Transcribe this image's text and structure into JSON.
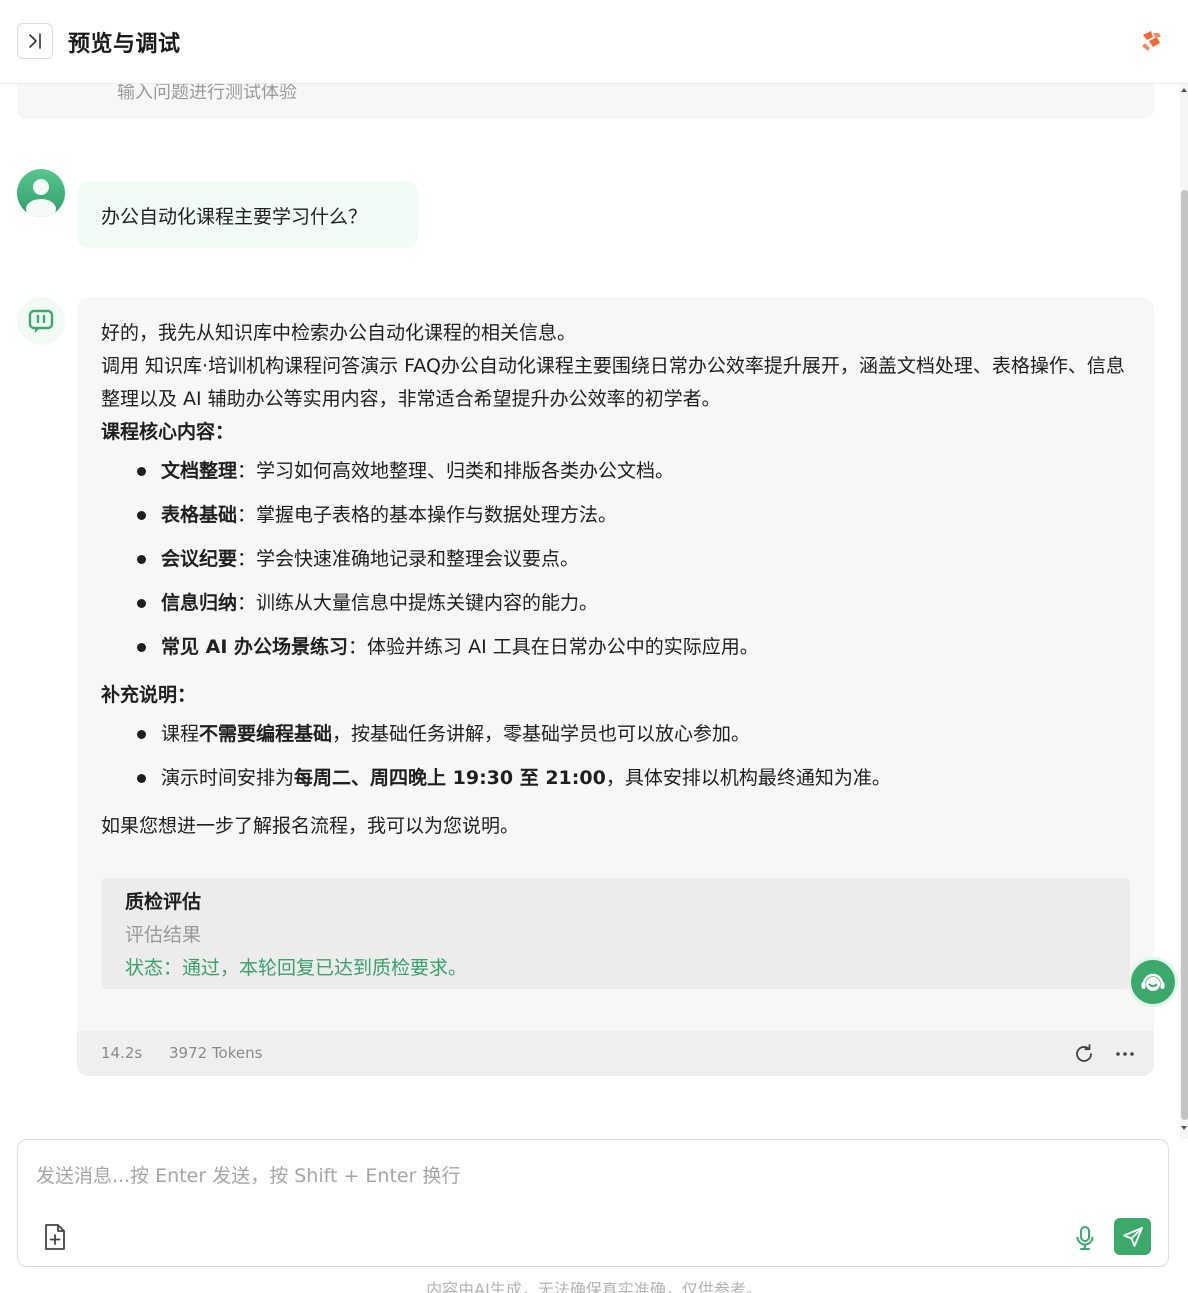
{
  "header": {
    "title": "预览与调试",
    "toggle_icon": "sidebar-expand-icon",
    "brand_icon": "brand-logo-icon",
    "brand_color": "#f2693a"
  },
  "intro": {
    "text": "输入问题进行测试体验"
  },
  "user_message": {
    "text": "办公自动化课程主要学习什么？"
  },
  "bot_message": {
    "line1": "好的，我先从知识库中检索办公自动化课程的相关信息。",
    "line2": "调用 知识库·培训机构课程问答演示 FAQ办公自动化课程主要围绕日常办公效率提升展开，涵盖文档处理、表格操作、信息整理以及 AI 辅助办公等实用内容，非常适合希望提升办公效率的初学者。",
    "core_heading": "课程核心内容：",
    "core_items": [
      {
        "title": "文档整理",
        "sep": "：",
        "desc": "学习如何高效地整理、归类和排版各类办公文档。"
      },
      {
        "title": "表格基础",
        "sep": "：",
        "desc": "掌握电子表格的基本操作与数据处理方法。"
      },
      {
        "title": "会议纪要",
        "sep": "：",
        "desc": "学会快速准确地记录和整理会议要点。"
      },
      {
        "title": "信息归纳",
        "sep": "：",
        "desc": "训练从大量信息中提炼关键内容的能力。"
      },
      {
        "title": "常见 AI 办公场景练习",
        "sep": "：",
        "desc": "体验并练习 AI 工具在日常办公中的实际应用。"
      }
    ],
    "extra_heading": "补充说明：",
    "extra_1": {
      "pre": "课程",
      "bold": "不需要编程基础",
      "post": "，按基础任务讲解，零基础学员也可以放心参加。"
    },
    "extra_2": {
      "pre": "演示时间安排为",
      "bold": "每周二、周四晚上 19:30 至 21:00",
      "post": "，具体安排以机构最终通知为准。"
    },
    "closing": "如果您想进一步了解报名流程，我可以为您说明。",
    "qc": {
      "title": "质检评估",
      "subtitle": "评估结果",
      "status": "状态：通过，本轮回复已达到质检要求。",
      "status_color": "#3aa16a"
    },
    "footer": {
      "time": "14.2s",
      "tokens": "3972 Tokens"
    }
  },
  "input": {
    "placeholder": "发送消息...按 Enter 发送，按 Shift + Enter 换行",
    "value": ""
  },
  "disclaimer": "内容由AI生成，无法确保真实准确，仅供参考。",
  "accent_color": "#3aa96a"
}
